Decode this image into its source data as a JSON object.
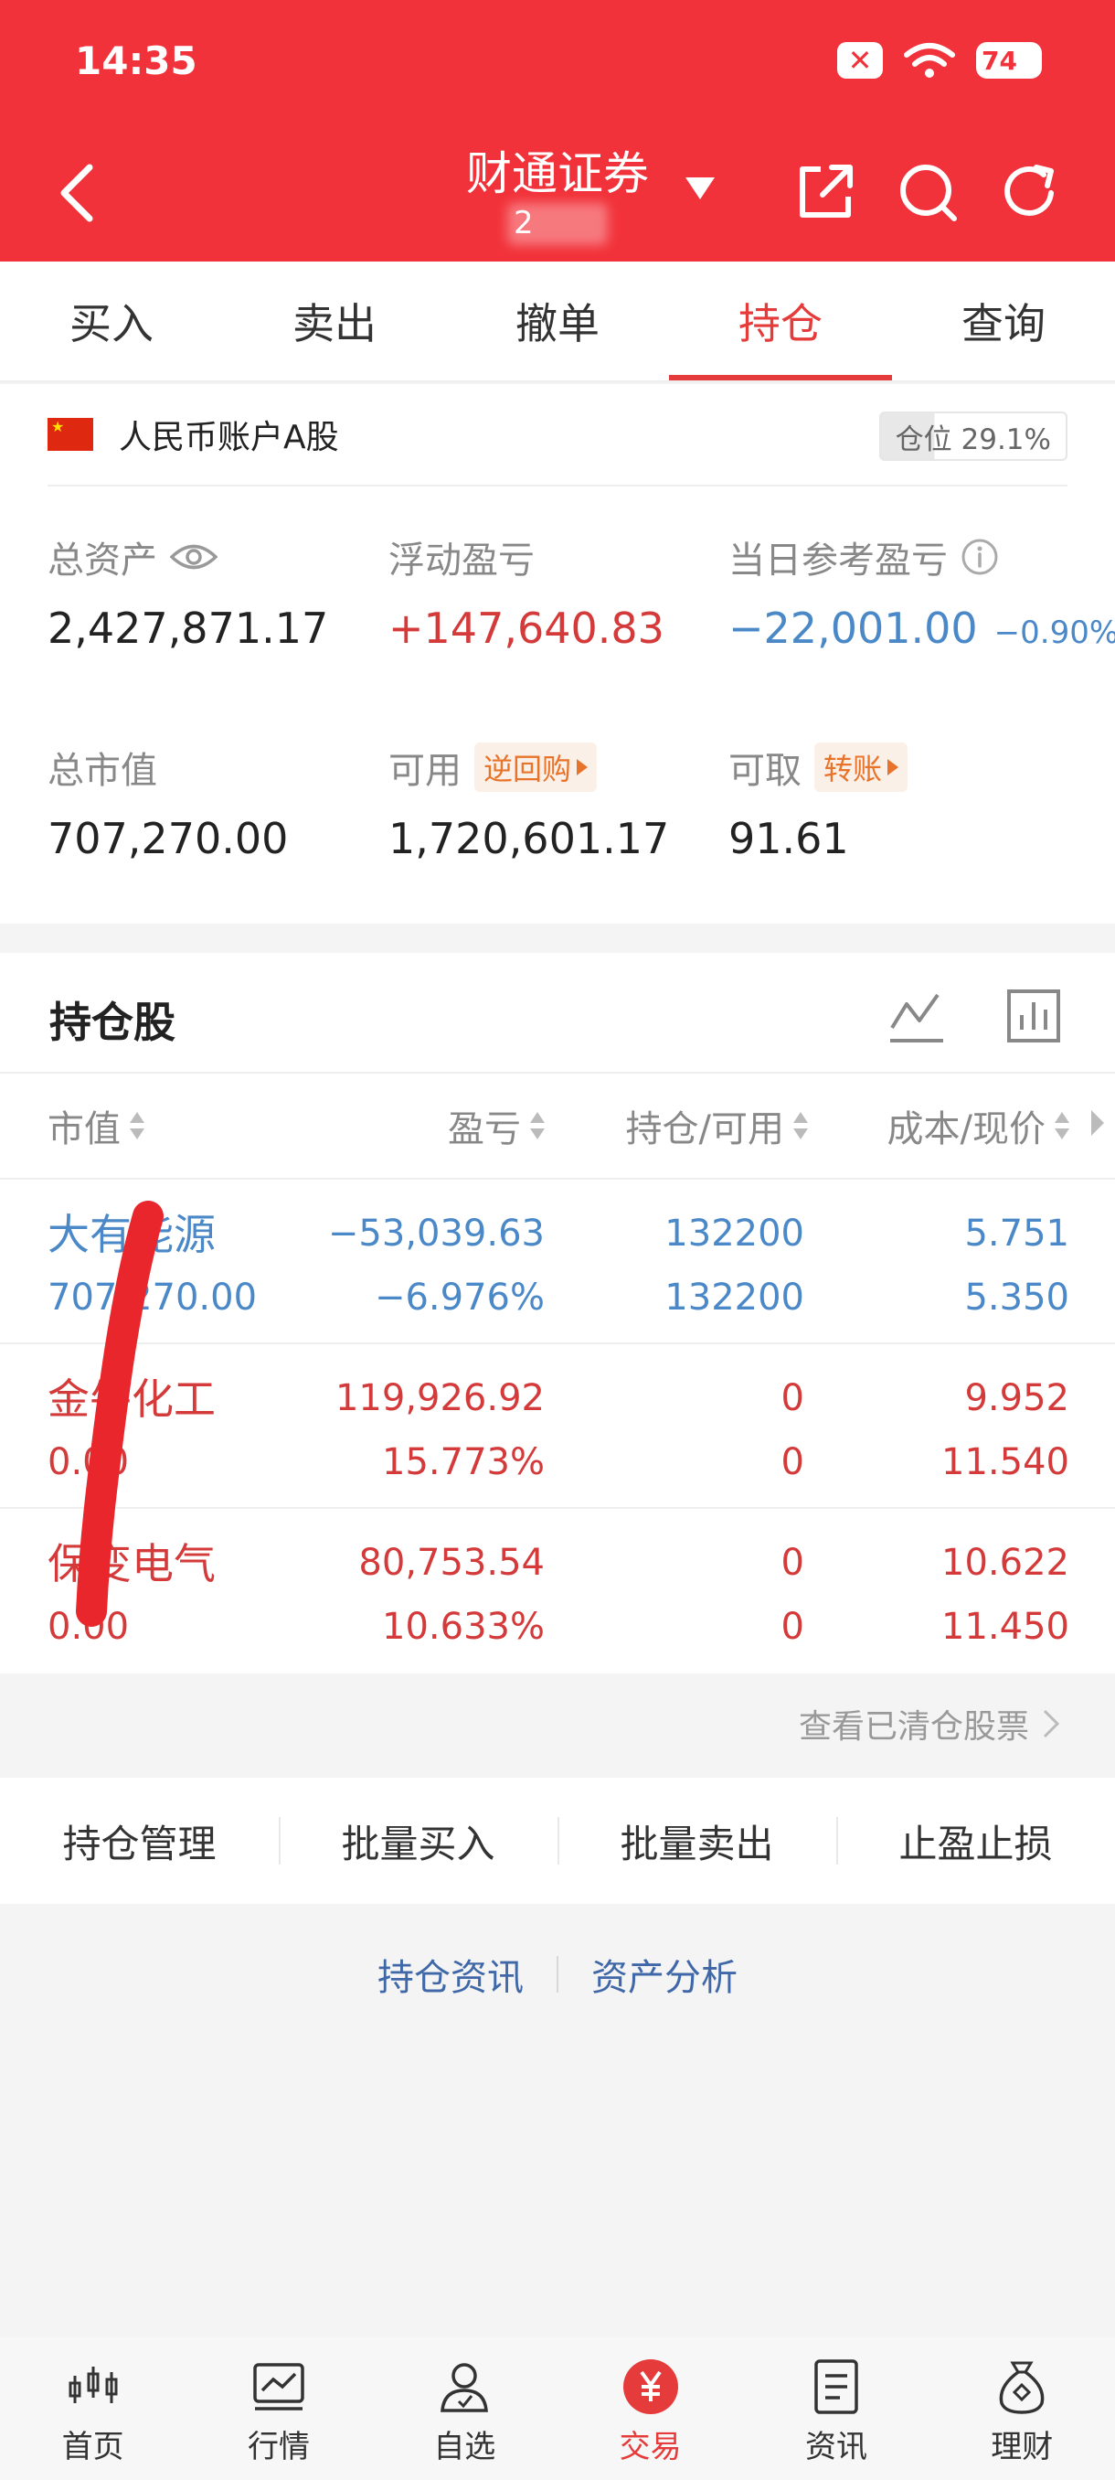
{
  "status_bar": {
    "time": "14:35",
    "battery": "74"
  },
  "header": {
    "title": "财通证券",
    "subtitle": "2"
  },
  "tabs": [
    {
      "label": "买入"
    },
    {
      "label": "卖出"
    },
    {
      "label": "撤单"
    },
    {
      "label": "持仓",
      "active": true
    },
    {
      "label": "查询"
    }
  ],
  "account": {
    "name": "人民币账户A股",
    "position_label": "仓位 29.1%",
    "position_fraction": 0.291
  },
  "metrics": {
    "total_assets": {
      "label": "总资产",
      "value": "2,427,871.17"
    },
    "floating_pl": {
      "label": "浮动盈亏",
      "value": "+147,640.83"
    },
    "daily_pl": {
      "label": "当日参考盈亏",
      "value": "−22,001.00",
      "pct": "−0.90%"
    },
    "market_value": {
      "label": "总市值",
      "value": "707,270.00"
    },
    "available": {
      "label": "可用",
      "tag": "逆回购",
      "value": "1,720,601.17"
    },
    "withdrawable": {
      "label": "可取",
      "tag": "转账",
      "value": "91.61"
    }
  },
  "holdings": {
    "title": "持仓股",
    "columns": [
      "市值",
      "盈亏",
      "持仓/可用",
      "成本/现价"
    ],
    "rows": [
      {
        "name": "大有能源",
        "market_value": "707,270.00",
        "pl": "−53,039.63",
        "pl_pct": "−6.976%",
        "position": "132200",
        "available": "132200",
        "cost": "5.751",
        "price": "5.350",
        "color": "#4a88c8"
      },
      {
        "name": "金牛化工",
        "market_value": "0.00",
        "pl": "119,926.92",
        "pl_pct": "15.773%",
        "position": "0",
        "available": "0",
        "cost": "9.952",
        "price": "11.540",
        "color": "#d43a3a"
      },
      {
        "name": "保变电气",
        "market_value": "0.00",
        "pl": "80,753.54",
        "pl_pct": "10.633%",
        "position": "0",
        "available": "0",
        "cost": "10.622",
        "price": "11.450",
        "color": "#d43a3a"
      }
    ],
    "cleared_link": "查看已清仓股票"
  },
  "actions": [
    "持仓管理",
    "批量买入",
    "批量卖出",
    "止盈止损"
  ],
  "links": [
    "持仓资讯",
    "资产分析"
  ],
  "bottom_nav": [
    {
      "label": "首页",
      "icon": "candlestick-icon"
    },
    {
      "label": "行情",
      "icon": "market-chart-icon"
    },
    {
      "label": "自选",
      "icon": "person-icon"
    },
    {
      "label": "交易",
      "icon": "yuan-icon",
      "active": true
    },
    {
      "label": "资讯",
      "icon": "news-icon"
    },
    {
      "label": "理财",
      "icon": "money-bag-icon"
    }
  ],
  "colors": {
    "brand_red": "#f2323a",
    "gain_red": "#d43a3a",
    "loss_blue": "#4a88c8",
    "tag_orange": "#e8732a",
    "link_blue": "#4068a8"
  }
}
